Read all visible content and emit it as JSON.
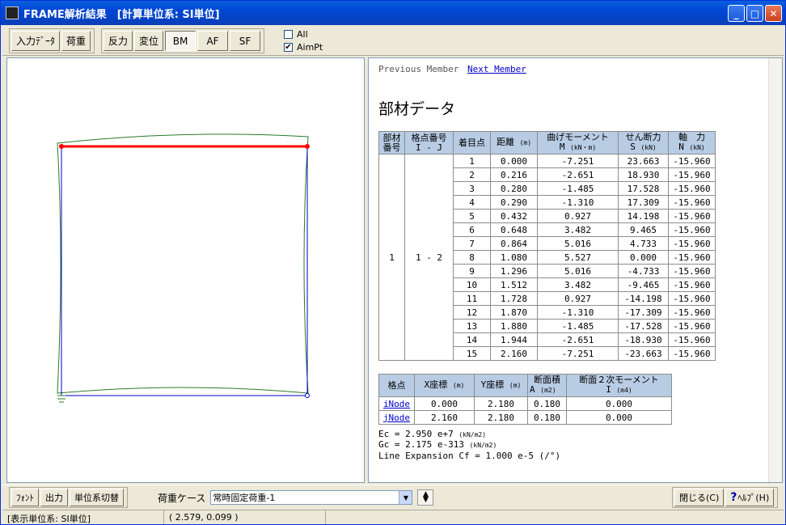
{
  "window": {
    "title": "FRAME解析結果　[計算単位系: SI単位]"
  },
  "toolbar": {
    "input_data": "入力ﾃﾞｰﾀ",
    "load": "荷重",
    "reaction": "反力",
    "displacement": "変位",
    "bm": "BM",
    "af": "AF",
    "sf": "SF",
    "all_label": "All",
    "all_checked": "",
    "aimpt_label": "AimPt",
    "aimpt_checked": "✔"
  },
  "nav": {
    "prev": "Previous Member",
    "next": "Next Member"
  },
  "section_title": "部材データ",
  "member_table": {
    "headers": {
      "member_no": [
        "部材",
        "番号"
      ],
      "node_no": [
        "格点番号",
        "I - J"
      ],
      "point": "着目点",
      "distance": "距離",
      "distance_unit": "(m)",
      "moment": "曲げモーメント",
      "moment_sym": "M",
      "moment_unit": "(kN・m)",
      "shear": "せん断力",
      "shear_sym": "S",
      "shear_unit": "(kN)",
      "axial": "軸　力",
      "axial_sym": "N",
      "axial_unit": "(kN)"
    },
    "member_no": "1",
    "node_ij": "1 - 2",
    "rows": [
      [
        "1",
        "0.000",
        "-7.251",
        "23.663",
        "-15.960"
      ],
      [
        "2",
        "0.216",
        "-2.651",
        "18.930",
        "-15.960"
      ],
      [
        "3",
        "0.280",
        "-1.485",
        "17.528",
        "-15.960"
      ],
      [
        "4",
        "0.290",
        "-1.310",
        "17.309",
        "-15.960"
      ],
      [
        "5",
        "0.432",
        "0.927",
        "14.198",
        "-15.960"
      ],
      [
        "6",
        "0.648",
        "3.482",
        "9.465",
        "-15.960"
      ],
      [
        "7",
        "0.864",
        "5.016",
        "4.733",
        "-15.960"
      ],
      [
        "8",
        "1.080",
        "5.527",
        "0.000",
        "-15.960"
      ],
      [
        "9",
        "1.296",
        "5.016",
        "-4.733",
        "-15.960"
      ],
      [
        "10",
        "1.512",
        "3.482",
        "-9.465",
        "-15.960"
      ],
      [
        "11",
        "1.728",
        "0.927",
        "-14.198",
        "-15.960"
      ],
      [
        "12",
        "1.870",
        "-1.310",
        "-17.309",
        "-15.960"
      ],
      [
        "13",
        "1.880",
        "-1.485",
        "-17.528",
        "-15.960"
      ],
      [
        "14",
        "1.944",
        "-2.651",
        "-18.930",
        "-15.960"
      ],
      [
        "15",
        "2.160",
        "-7.251",
        "-23.663",
        "-15.960"
      ]
    ]
  },
  "node_table": {
    "headers": {
      "node": "格点",
      "x": "X座標",
      "x_unit": "(m)",
      "y": "Y座標",
      "y_unit": "(m)",
      "area": "断面積",
      "area_sym": "A",
      "area_unit": "(m2)",
      "inertia": "断面２次モーメント",
      "inertia_sym": "I",
      "inertia_unit": "(m4)"
    },
    "rows": [
      [
        "iNode",
        "0.000",
        "2.180",
        "0.180",
        "0.000"
      ],
      [
        "jNode",
        "2.160",
        "2.180",
        "0.180",
        "0.000"
      ]
    ]
  },
  "footer": {
    "ec": "Ec = 2.950 e+7",
    "ec_unit": "(kN/m2)",
    "gc": "Gc = 2.175 e-313",
    "gc_unit": "(kN/m2)",
    "line_expansion": "Line Expansion Cf = 1.000 e-5 (/°)"
  },
  "bottom": {
    "font": "ﾌｫﾝﾄ",
    "output": "出力",
    "unit_switch": "単位系切替",
    "load_case_label": "荷重ケース",
    "load_case_value": "常時固定荷重-1",
    "close": "閉じる(C)",
    "help": "ﾍﾙﾌﾟ(H)"
  },
  "status": {
    "unit": "[表示単位系: SI単位]",
    "coords": "(     2.579,     0.099 )"
  },
  "colors": {
    "selected_member": "#ff0000",
    "frame": "#0000cc",
    "diagram": "#2a7a2a",
    "table_header": "#b8cce4"
  }
}
